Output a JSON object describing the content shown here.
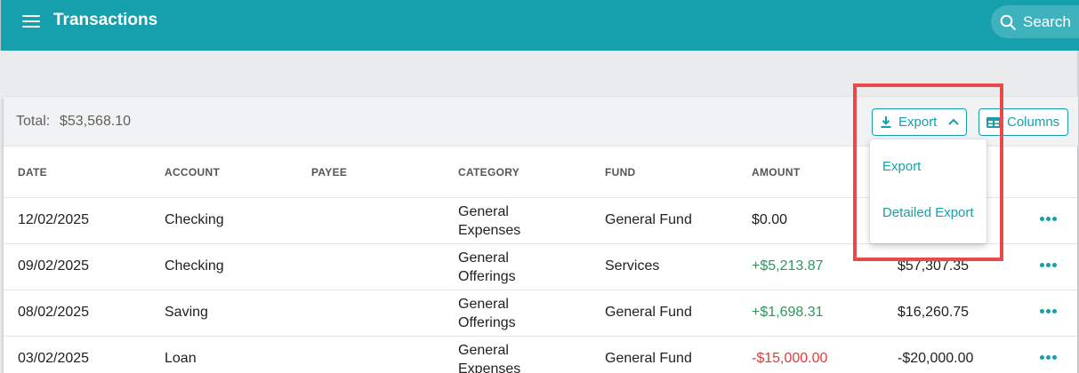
{
  "header": {
    "title": "Transactions",
    "search_label": "Search",
    "color": "#169fac"
  },
  "summary": {
    "total_label": "Total:",
    "total_value": "$53,568.10"
  },
  "toolbar": {
    "export_label": "Export",
    "columns_label": "Columns"
  },
  "export_menu": {
    "items": [
      "Export",
      "Detailed Export"
    ]
  },
  "table": {
    "columns": [
      "DATE",
      "ACCOUNT",
      "PAYEE",
      "CATEGORY",
      "FUND",
      "AMOUNT"
    ],
    "rows": [
      {
        "date": "12/02/2025",
        "account": "Checking",
        "payee": "",
        "category_line1": "General",
        "category_line2": "Expenses",
        "fund": "General Fund",
        "amount": "$0.00",
        "balance": ""
      },
      {
        "date": "09/02/2025",
        "account": "Checking",
        "payee": "",
        "category_line1": "General",
        "category_line2": "Offerings",
        "fund": "Services",
        "amount": "+$5,213.87",
        "balance": "$57,307.35"
      },
      {
        "date": "08/02/2025",
        "account": "Saving",
        "payee": "",
        "category_line1": "General",
        "category_line2": "Offerings",
        "fund": "General Fund",
        "amount": "+$1,698.31",
        "balance": "$16,260.75"
      },
      {
        "date": "03/02/2025",
        "account": "Loan",
        "payee": "",
        "category_line1": "General",
        "category_line2": "Expenses",
        "fund": "General Fund",
        "amount": "-$15,000.00",
        "balance": "-$20,000.00"
      }
    ]
  },
  "colors": {
    "accent": "#169fac",
    "positive": "#2a9a5b",
    "negative": "#e53935",
    "highlight_box": "#e84a4a"
  }
}
